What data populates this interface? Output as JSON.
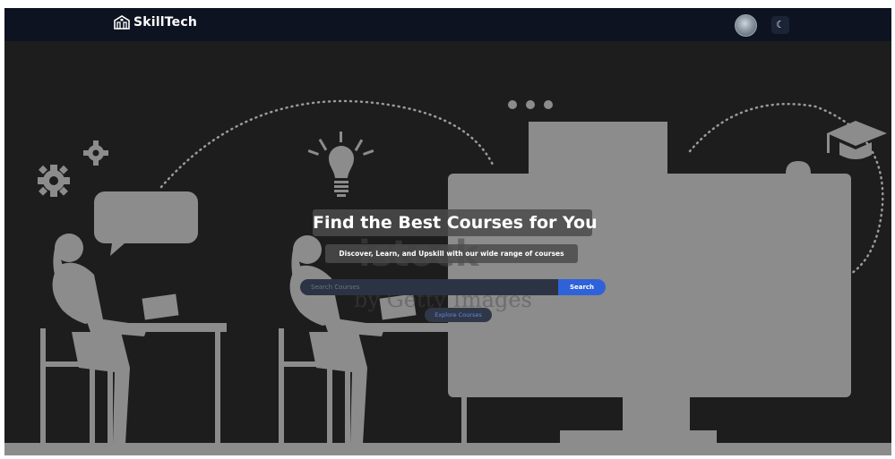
{
  "navbar": {
    "brand_name": "SkillTech",
    "brand_icon": "building-icon",
    "profile_avatar": "user-avatar",
    "theme_toggle_icon": "moon-icon",
    "theme_toggle_glyph": "☾"
  },
  "hero": {
    "title": "Find the Best Courses for You",
    "subtitle": "Discover, Learn, and Upskill with our wide range of courses",
    "search": {
      "placeholder": "Search Courses",
      "value": "",
      "button_label": "Search"
    },
    "explore_label": "Explore Courses",
    "watermark": "istock",
    "watermark_sub": "by Getty Images"
  },
  "colors": {
    "navbar_bg": "#0d1321",
    "hero_bg": "#1d1d1d",
    "illustration": "#8c8c8c",
    "accent": "#2f62d8",
    "overlay": "#4b4b4b"
  }
}
